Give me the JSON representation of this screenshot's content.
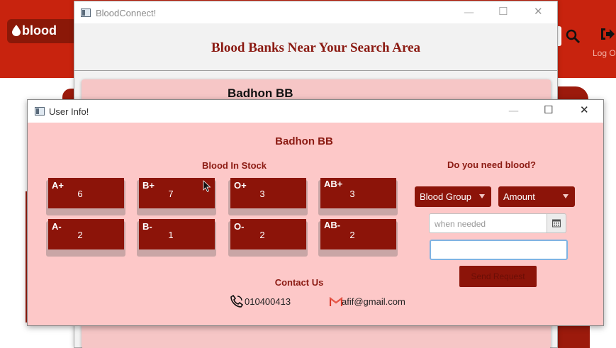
{
  "background_app": {
    "logo_text": "blood",
    "logout_label": "Log O"
  },
  "bloodconnect_window": {
    "title": "BloodConnect!",
    "heading": "Blood Banks Near Your Search Area",
    "bank_card_title": "Badhon BB"
  },
  "user_info_window": {
    "title": "User Info!",
    "bank_name": "Badhon BB",
    "stock_label": "Blood In Stock",
    "need_label": "Do you need blood?",
    "stock": [
      {
        "type": "A+",
        "count": "6"
      },
      {
        "type": "B+",
        "count": "7"
      },
      {
        "type": "O+",
        "count": "3"
      },
      {
        "type": "AB+",
        "count": "3"
      },
      {
        "type": "A-",
        "count": "2"
      },
      {
        "type": "B-",
        "count": "1"
      },
      {
        "type": "O-",
        "count": "2"
      },
      {
        "type": "AB-",
        "count": "2"
      }
    ],
    "blood_group_select": "Blood Group",
    "amount_select": "Amount",
    "date_placeholder": "when needed",
    "send_button": "Send Request",
    "contact_label": "Contact Us",
    "phone": "010400413",
    "email": "afif@gmail.com"
  },
  "colors": {
    "brand_red": "#c8230e",
    "dark_red": "#8c1409",
    "panel_pink": "#fdc8c8",
    "heading_red": "#8b1a12"
  }
}
